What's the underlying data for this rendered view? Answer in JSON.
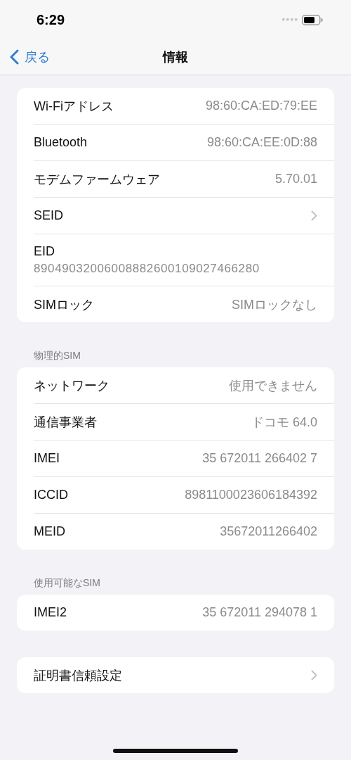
{
  "status_bar": {
    "time": "6:29"
  },
  "nav": {
    "back": "戻る",
    "title": "情報"
  },
  "sections": [
    {
      "rows": [
        {
          "kind": "value",
          "label": "Wi-Fiアドレス",
          "value": "98:60:CA:ED:79:EE"
        },
        {
          "kind": "value",
          "label": "Bluetooth",
          "value": "98:60:CA:EE:0D:88"
        },
        {
          "kind": "value",
          "label": "モデムファームウェア",
          "value": "5.70.01"
        },
        {
          "kind": "chevron",
          "label": "SEID"
        },
        {
          "kind": "stacked",
          "label": "EID",
          "value": "89049032006008882600109027466280"
        },
        {
          "kind": "value",
          "label": "SIMロック",
          "value": "SIMロックなし"
        }
      ]
    },
    {
      "header": "物理的SIM",
      "rows": [
        {
          "kind": "value",
          "label": "ネットワーク",
          "value": "使用できません"
        },
        {
          "kind": "value",
          "label": "通信事業者",
          "value": "ドコモ 64.0"
        },
        {
          "kind": "value",
          "label": "IMEI",
          "value": "35 672011 266402 7"
        },
        {
          "kind": "value",
          "label": "ICCID",
          "value": "8981100023606184392"
        },
        {
          "kind": "value",
          "label": "MEID",
          "value": "35672011266402"
        }
      ]
    },
    {
      "header": "使用可能なSIM",
      "rows": [
        {
          "kind": "value",
          "label": "IMEI2",
          "value": "35 672011 294078 1"
        }
      ]
    },
    {
      "rows": [
        {
          "kind": "chevron",
          "label": "証明書信頼設定"
        }
      ]
    }
  ]
}
